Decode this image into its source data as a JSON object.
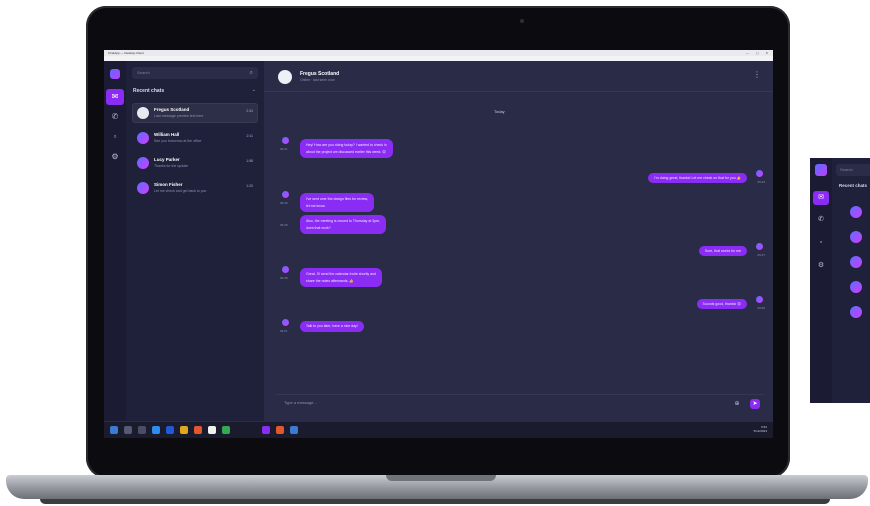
{
  "window": {
    "title": "ChatApp — Desktop Client",
    "menu": [
      "File",
      "View",
      "Help"
    ],
    "controls": "— ▢ ✕"
  },
  "rail": {
    "items": [
      "chats",
      "calls",
      "archive",
      "settings"
    ]
  },
  "chat_list": {
    "search_placeholder": "Search",
    "section_title": "Recent chats",
    "chats": [
      {
        "name": "Fregus Scotland",
        "preview": "Last message preview text here",
        "time": "2:34"
      },
      {
        "name": "William Hall",
        "preview": "See you tomorrow at the office",
        "time": "2:11"
      },
      {
        "name": "Lucy Parker",
        "preview": "Thanks for the update",
        "time": "1:58"
      },
      {
        "name": "Simon Fisher",
        "preview": "Let me check and get back to you",
        "time": "1:20"
      }
    ]
  },
  "conversation": {
    "contact_name": "Fregus Scotland",
    "contact_status": "Online · last seen now",
    "day_label": "Today",
    "messages": [
      {
        "dir": "in",
        "lines": [
          "Hey! How are you doing today? I wanted to check in",
          "about the project we discussed earlier this week. 😊"
        ],
        "time": "09:41"
      },
      {
        "dir": "out",
        "lines": [
          "I'm doing great, thanks! Let me check on that for you 👍"
        ],
        "time": "09:43"
      },
      {
        "dir": "in",
        "lines": [
          "I've sent over the design files for review,",
          "let me know."
        ],
        "time": "09:45"
      },
      {
        "dir": "in",
        "lines": [
          "Also, the meeting is moved to Thursday at 3pm,",
          "does that work?"
        ],
        "time": "09:45"
      },
      {
        "dir": "out",
        "lines": [
          "Sure, that works for me"
        ],
        "time": "09:47"
      },
      {
        "dir": "in",
        "lines": [
          "Great, I'll send the calendar invite shortly and",
          "share the notes afterwards. 👍"
        ],
        "time": "09:48"
      },
      {
        "dir": "out",
        "lines": [
          "Sounds good, thanks! 😊"
        ],
        "time": "09:50"
      },
      {
        "dir": "in",
        "lines": [
          "Talk to you later, have a nice day!"
        ],
        "time": "09:51"
      }
    ],
    "composer_placeholder": "Type a message..."
  },
  "taskbar": {
    "time": "9:52",
    "date": "5/12/2023"
  },
  "side_panel": {
    "search_placeholder": "Search",
    "section_title": "Recent chats"
  },
  "colors": {
    "accent": "#8b2cf5",
    "bg": "#262843",
    "sidebar": "#1f213b"
  }
}
